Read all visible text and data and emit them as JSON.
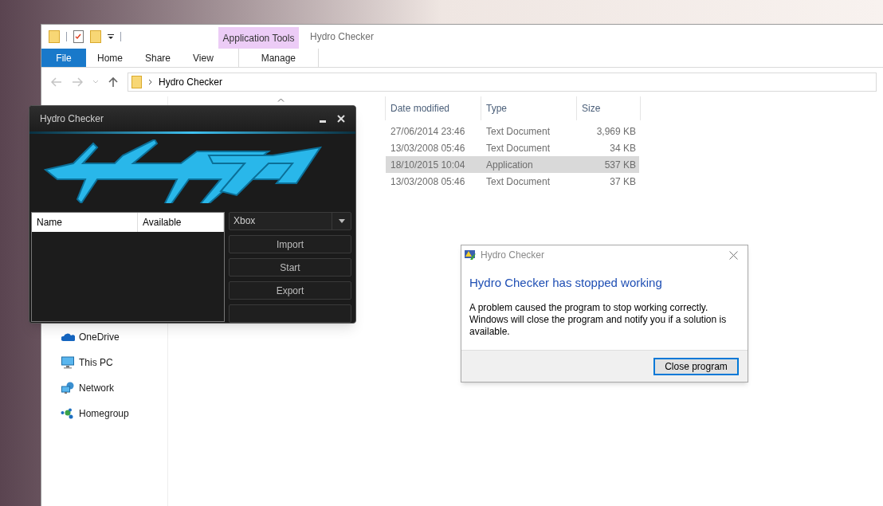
{
  "explorer": {
    "title": "Hydro Checker",
    "contextual_group": "Application Tools",
    "ribbon_tabs": [
      {
        "label": "File",
        "kind": "file"
      },
      {
        "label": "Home",
        "kind": "tab"
      },
      {
        "label": "Share",
        "kind": "tab"
      },
      {
        "label": "View",
        "kind": "tab"
      },
      {
        "label": "Manage",
        "kind": "contextual"
      }
    ],
    "address": "Hydro Checker",
    "columns": [
      "Date modified",
      "Type",
      "Size"
    ],
    "rows": [
      {
        "date": "27/06/2014 23:46",
        "type": "Text Document",
        "size": "3,969 KB",
        "selected": false
      },
      {
        "date": "13/03/2008 05:46",
        "type": "Text Document",
        "size": "34 KB",
        "selected": false
      },
      {
        "date": "18/10/2015 10:04",
        "type": "Application",
        "size": "537 KB",
        "selected": true
      },
      {
        "date": "13/03/2008 05:46",
        "type": "Text Document",
        "size": "37 KB",
        "selected": false
      }
    ],
    "nav_items": [
      {
        "label": "OneDrive",
        "kind": "cloud"
      },
      {
        "label": "This PC",
        "kind": "computer"
      },
      {
        "label": "Network",
        "kind": "network"
      },
      {
        "label": "Homegroup",
        "kind": "homegroup"
      }
    ]
  },
  "hydro_app": {
    "title": "Hydro Checker",
    "list_columns": [
      "Name",
      "Available"
    ],
    "dropdown": "Xbox",
    "buttons": [
      "Import",
      "Start",
      "Export"
    ]
  },
  "error_dialog": {
    "title": "Hydro Checker",
    "heading": "Hydro Checker has stopped working",
    "message": "A problem caused the program to stop working correctly. Windows will close the program and notify you if a solution is available.",
    "button": "Close program"
  }
}
